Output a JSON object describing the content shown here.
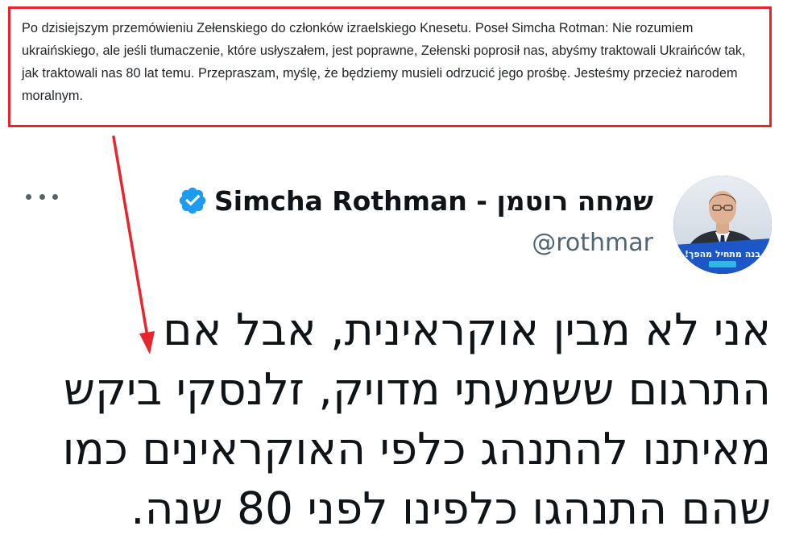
{
  "caption": {
    "text": "Po dzisiejszym przemówieniu Zełenskiego do członków izraelskiego Knesetu. Poseł Simcha Rotman: Nie rozumiem ukraińskiego, ale jeśli tłumaczenie, które usłyszałem, jest poprawne, Zełenski poprosił nas, abyśmy traktowali Ukraińców tak, jak traktowali nas 80 lat temu. Przepraszam, myślę, że będziemy musieli odrzucić jego prośbę. Jesteśmy przecież narodem moralnym.",
    "border_color": "#e8242c"
  },
  "arrow": {
    "color": "#e8242c"
  },
  "tweet": {
    "display_name": "שמחה רוטמן - Simcha Rothman",
    "handle": "@rothmar",
    "verified": true,
    "verified_color": "#1d9bf0",
    "more_icon": "more-horizontal-icon",
    "avatar_banner_text": "בנה מתחיל מהפך!",
    "text": "אני לא מבין אוקראינית, אבל אם התרגום ששמעתי מדויק, זלנסקי ביקש מאיתנו להתנהג כלפי האוקראינים כמו שהם התנהגו כלפינו לפני 80 שנה."
  }
}
